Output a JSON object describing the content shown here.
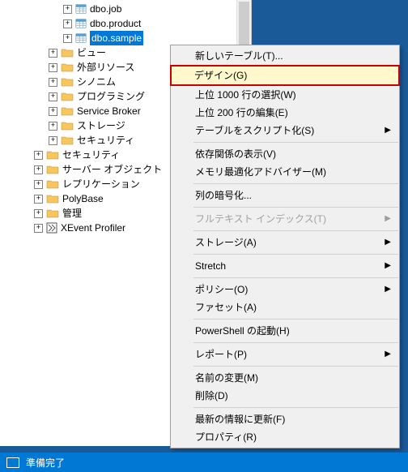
{
  "tree": {
    "tables": [
      {
        "name": "dbo.job"
      },
      {
        "name": "dbo.product"
      },
      {
        "name": "dbo.sample",
        "selected": true
      }
    ],
    "subfolders": [
      "ビュー",
      "外部リソース",
      "シノニム",
      "プログラミング",
      "Service Broker",
      "ストレージ",
      "セキュリティ"
    ],
    "folders": [
      "セキュリティ",
      "サーバー オブジェクト",
      "レプリケーション",
      "PolyBase",
      "管理"
    ],
    "xevent": "XEvent Profiler"
  },
  "ctx": {
    "new_table": "新しいテーブル(T)...",
    "design": "デザイン(G)",
    "select_top": "上位 1000 行の選択(W)",
    "edit_top": "上位 200 行の編集(E)",
    "script": "テーブルをスクリプト化(S)",
    "deps": "依存関係の表示(V)",
    "mem_adv": "メモリ最適化アドバイザー(M)",
    "encrypt": "列の暗号化...",
    "ftidx": "フルテキスト インデックス(T)",
    "storage": "ストレージ(A)",
    "stretch": "Stretch",
    "policy": "ポリシー(O)",
    "facet": "ファセット(A)",
    "ps": "PowerShell の起動(H)",
    "report": "レポート(P)",
    "rename": "名前の変更(M)",
    "delete": "削除(D)",
    "refresh": "最新の情報に更新(F)",
    "props": "プロパティ(R)"
  },
  "status": "準備完了"
}
